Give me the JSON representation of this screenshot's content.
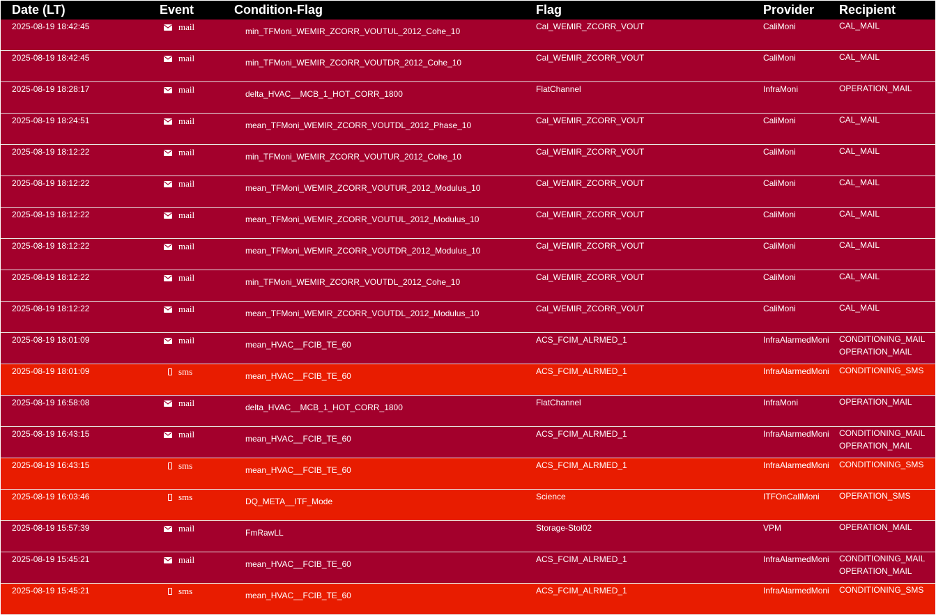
{
  "headers": {
    "date": "Date (LT)",
    "event": "Event",
    "condition": "Condition-Flag",
    "flag": "Flag",
    "provider": "Provider",
    "recipient": "Recipient"
  },
  "colors": {
    "header_bg": "#000000",
    "mail_row_bg": "#a3002c",
    "sms_row_bg": "#e81c00",
    "text": "#ffffff"
  },
  "event_icons": {
    "mail": "envelope-icon",
    "sms": "mobile-phone-icon"
  },
  "rows": [
    {
      "date": "2025-08-19 18:42:45",
      "event": "mail",
      "condition": "min_TFMoni_WEMIR_ZCORR_VOUTUL_2012_Cohe_10",
      "flag": "Cal_WEMIR_ZCORR_VOUT",
      "provider": "CaliMoni",
      "recipients": [
        "CAL_MAIL"
      ]
    },
    {
      "date": "2025-08-19 18:42:45",
      "event": "mail",
      "condition": "min_TFMoni_WEMIR_ZCORR_VOUTDR_2012_Cohe_10",
      "flag": "Cal_WEMIR_ZCORR_VOUT",
      "provider": "CaliMoni",
      "recipients": [
        "CAL_MAIL"
      ]
    },
    {
      "date": "2025-08-19 18:28:17",
      "event": "mail",
      "condition": "delta_HVAC__MCB_1_HOT_CORR_1800",
      "flag": "FlatChannel",
      "provider": "InfraMoni",
      "recipients": [
        "OPERATION_MAIL"
      ]
    },
    {
      "date": "2025-08-19 18:24:51",
      "event": "mail",
      "condition": "mean_TFMoni_WEMIR_ZCORR_VOUTDL_2012_Phase_10",
      "flag": "Cal_WEMIR_ZCORR_VOUT",
      "provider": "CaliMoni",
      "recipients": [
        "CAL_MAIL"
      ]
    },
    {
      "date": "2025-08-19 18:12:22",
      "event": "mail",
      "condition": "min_TFMoni_WEMIR_ZCORR_VOUTUR_2012_Cohe_10",
      "flag": "Cal_WEMIR_ZCORR_VOUT",
      "provider": "CaliMoni",
      "recipients": [
        "CAL_MAIL"
      ]
    },
    {
      "date": "2025-08-19 18:12:22",
      "event": "mail",
      "condition": "mean_TFMoni_WEMIR_ZCORR_VOUTUR_2012_Modulus_10",
      "flag": "Cal_WEMIR_ZCORR_VOUT",
      "provider": "CaliMoni",
      "recipients": [
        "CAL_MAIL"
      ]
    },
    {
      "date": "2025-08-19 18:12:22",
      "event": "mail",
      "condition": "mean_TFMoni_WEMIR_ZCORR_VOUTUL_2012_Modulus_10",
      "flag": "Cal_WEMIR_ZCORR_VOUT",
      "provider": "CaliMoni",
      "recipients": [
        "CAL_MAIL"
      ]
    },
    {
      "date": "2025-08-19 18:12:22",
      "event": "mail",
      "condition": "mean_TFMoni_WEMIR_ZCORR_VOUTDR_2012_Modulus_10",
      "flag": "Cal_WEMIR_ZCORR_VOUT",
      "provider": "CaliMoni",
      "recipients": [
        "CAL_MAIL"
      ]
    },
    {
      "date": "2025-08-19 18:12:22",
      "event": "mail",
      "condition": "min_TFMoni_WEMIR_ZCORR_VOUTDL_2012_Cohe_10",
      "flag": "Cal_WEMIR_ZCORR_VOUT",
      "provider": "CaliMoni",
      "recipients": [
        "CAL_MAIL"
      ]
    },
    {
      "date": "2025-08-19 18:12:22",
      "event": "mail",
      "condition": "mean_TFMoni_WEMIR_ZCORR_VOUTDL_2012_Modulus_10",
      "flag": "Cal_WEMIR_ZCORR_VOUT",
      "provider": "CaliMoni",
      "recipients": [
        "CAL_MAIL"
      ]
    },
    {
      "date": "2025-08-19 18:01:09",
      "event": "mail",
      "condition": "mean_HVAC__FCIB_TE_60",
      "flag": "ACS_FCIM_ALRMED_1",
      "provider": "InfraAlarmedMoni",
      "recipients": [
        "CONDITIONING_MAIL",
        "OPERATION_MAIL"
      ]
    },
    {
      "date": "2025-08-19 18:01:09",
      "event": "sms",
      "condition": "mean_HVAC__FCIB_TE_60",
      "flag": "ACS_FCIM_ALRMED_1",
      "provider": "InfraAlarmedMoni",
      "recipients": [
        "CONDITIONING_SMS"
      ]
    },
    {
      "date": "2025-08-19 16:58:08",
      "event": "mail",
      "condition": "delta_HVAC__MCB_1_HOT_CORR_1800",
      "flag": "FlatChannel",
      "provider": "InfraMoni",
      "recipients": [
        "OPERATION_MAIL"
      ]
    },
    {
      "date": "2025-08-19 16:43:15",
      "event": "mail",
      "condition": "mean_HVAC__FCIB_TE_60",
      "flag": "ACS_FCIM_ALRMED_1",
      "provider": "InfraAlarmedMoni",
      "recipients": [
        "CONDITIONING_MAIL",
        "OPERATION_MAIL"
      ]
    },
    {
      "date": "2025-08-19 16:43:15",
      "event": "sms",
      "condition": "mean_HVAC__FCIB_TE_60",
      "flag": "ACS_FCIM_ALRMED_1",
      "provider": "InfraAlarmedMoni",
      "recipients": [
        "CONDITIONING_SMS"
      ]
    },
    {
      "date": "2025-08-19 16:03:46",
      "event": "sms",
      "condition": "DQ_META__ITF_Mode",
      "flag": "Science",
      "provider": "ITFOnCallMoni",
      "recipients": [
        "OPERATION_SMS"
      ]
    },
    {
      "date": "2025-08-19 15:57:39",
      "event": "mail",
      "condition": "FmRawLL",
      "flag": "Storage-Stol02",
      "provider": "VPM",
      "recipients": [
        "OPERATION_MAIL"
      ]
    },
    {
      "date": "2025-08-19 15:45:21",
      "event": "mail",
      "condition": "mean_HVAC__FCIB_TE_60",
      "flag": "ACS_FCIM_ALRMED_1",
      "provider": "InfraAlarmedMoni",
      "recipients": [
        "CONDITIONING_MAIL",
        "OPERATION_MAIL"
      ]
    },
    {
      "date": "2025-08-19 15:45:21",
      "event": "sms",
      "condition": "mean_HVAC__FCIB_TE_60",
      "flag": "ACS_FCIM_ALRMED_1",
      "provider": "InfraAlarmedMoni",
      "recipients": [
        "CONDITIONING_SMS"
      ]
    }
  ]
}
